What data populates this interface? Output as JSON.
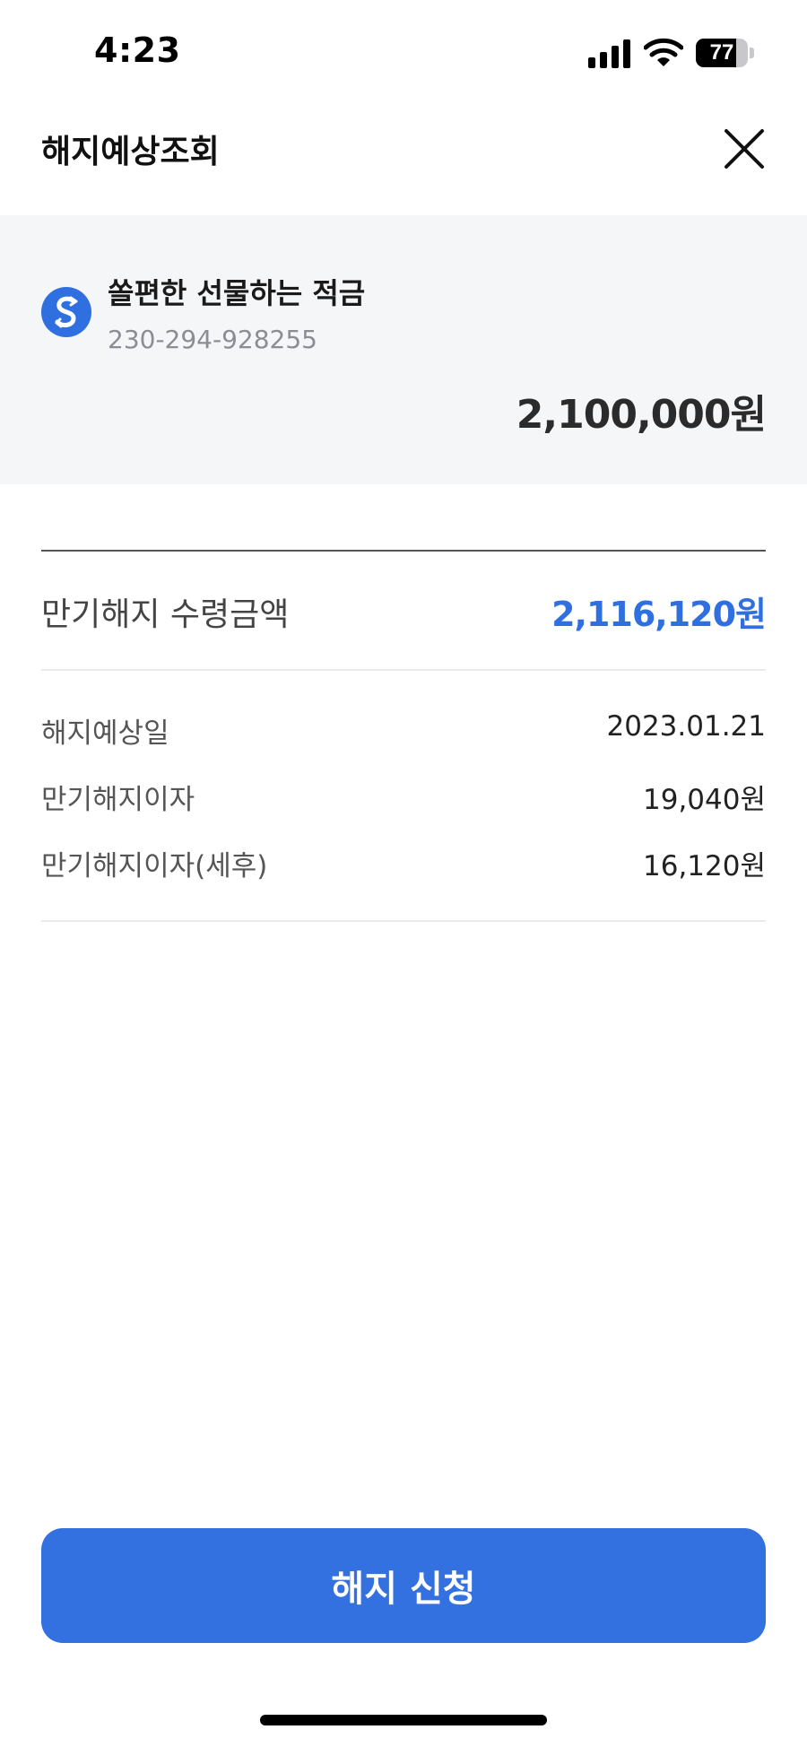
{
  "status_bar": {
    "time": "4:23",
    "battery_level": "77",
    "battery_fraction": 0.77,
    "icons": [
      "signal-icon",
      "wifi-icon",
      "battery-icon"
    ]
  },
  "header": {
    "title": "해지예상조회",
    "close_icon": "close-icon"
  },
  "account": {
    "logo_icon": "bank-logo-icon",
    "product_name": "쏠편한 선물하는 적금",
    "account_number": "230-294-928255",
    "balance": "2,100,000원"
  },
  "summary": {
    "payout_label": "만기해지 수령금액",
    "payout_value": "2,116,120원",
    "rows": [
      {
        "label": "해지예상일",
        "value": "2023.01.21"
      },
      {
        "label": "만기해지이자",
        "value": "19,040원"
      },
      {
        "label": "만기해지이자(세후)",
        "value": "16,120원"
      }
    ]
  },
  "cta": {
    "label": "해지 신청"
  },
  "colors": {
    "accent": "#3370e0",
    "payout_value": "#2f6fe0",
    "card_background": "#f5f6f8",
    "logo": "#2f6fe0"
  }
}
